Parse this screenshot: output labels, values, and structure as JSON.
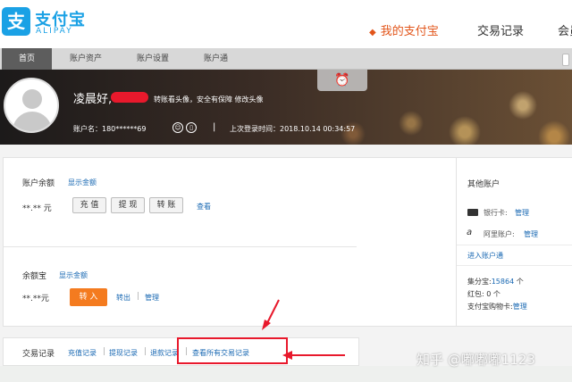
{
  "header": {
    "logo_cn": "支付宝",
    "logo_en": "ALIPAY",
    "logo_mark": "支",
    "nav_dot": "◆",
    "nav_mine": "我的支付宝",
    "nav_trade": "交易记录",
    "nav_member": "会员"
  },
  "subnav": {
    "items": [
      "首页",
      "账户资产",
      "账户设置",
      "账户通"
    ]
  },
  "banner": {
    "greeting": "凌晨好,",
    "greet_links": "转账看头像，安全有保障 修改头像",
    "account": "账户名：180******69",
    "last_login": "上次登录时间：2018.10.14 00:34:57",
    "clock_icon": "⏰",
    "sep": "|"
  },
  "balance": {
    "label": "账户余额",
    "show_link": "显示金额",
    "amount": "**.** 元",
    "buttons": [
      "充 值",
      "提 现",
      "转 账"
    ],
    "view_link": "查看"
  },
  "yuebao": {
    "label": "余额宝",
    "show_link": "显示金额",
    "amount": "**.**元",
    "buy_button": "转 入",
    "out_link": "转出",
    "manage_link": "管理"
  },
  "side": {
    "title": "其他账户",
    "bank_label": "银行卡:",
    "bank_link": "管理",
    "ali_label": "阿里账户:",
    "ali_link": "管理",
    "entry_link": "进入账户通",
    "points_label": "集分宝:",
    "points_value": "15864",
    "points_unit": "个",
    "redpacket_label": "红包:",
    "redpacket_value": "0 个",
    "shopcard_label": "支付宝购物卡:",
    "shopcard_link": "管理"
  },
  "trades": {
    "label": "交易记录",
    "links": [
      "充值记录",
      "提现记录",
      "退款记录",
      "查看所有交易记录"
    ]
  },
  "watermark": "知乎 @嘟嘟嘟1123",
  "colors": {
    "brand_blue": "#1aa1e5",
    "accent_orange": "#e2551a",
    "button_orange": "#f47b1f",
    "link_blue": "#1a69b3",
    "annotation_red": "#e8192c"
  }
}
